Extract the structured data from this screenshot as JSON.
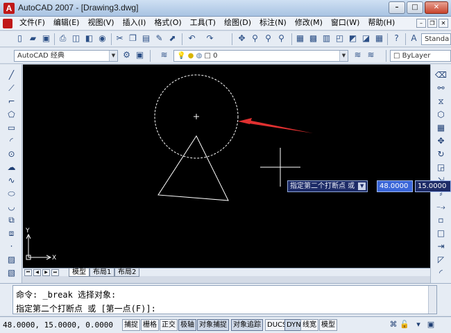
{
  "window": {
    "title": "AutoCAD 2007 - [Drawing3.dwg]",
    "app_icon": "A",
    "controls": [
      "minimize",
      "maximize",
      "close"
    ]
  },
  "menu": {
    "items": [
      "文件(F)",
      "编辑(E)",
      "视图(V)",
      "插入(I)",
      "格式(O)",
      "工具(T)",
      "绘图(D)",
      "标注(N)",
      "修改(M)",
      "窗口(W)",
      "帮助(H)"
    ]
  },
  "toolbar": {
    "text_style": "Standa",
    "workspace": "AutoCAD 经典",
    "layer": "0",
    "color": "ByLayer"
  },
  "drawing": {
    "dynamic_prompt": "指定第二个打断点 或",
    "input_x": "48.0000",
    "input_y": "15.0000",
    "ucs_x": "X",
    "ucs_y": "Y"
  },
  "tabs": {
    "model": "模型",
    "layout1": "布局1",
    "layout2": "布局2"
  },
  "command": {
    "line1": "命令: _break 选择对象:",
    "line2": "指定第二个打断点 或 [第一点(F)]:"
  },
  "status": {
    "coords": "48.0000, 15.0000, 0.0000",
    "buttons": [
      "捕捉",
      "栅格",
      "正交",
      "极轴",
      "对象捕捉",
      "对象追踪",
      "DUCS",
      "DYN",
      "线宽",
      "模型"
    ]
  }
}
